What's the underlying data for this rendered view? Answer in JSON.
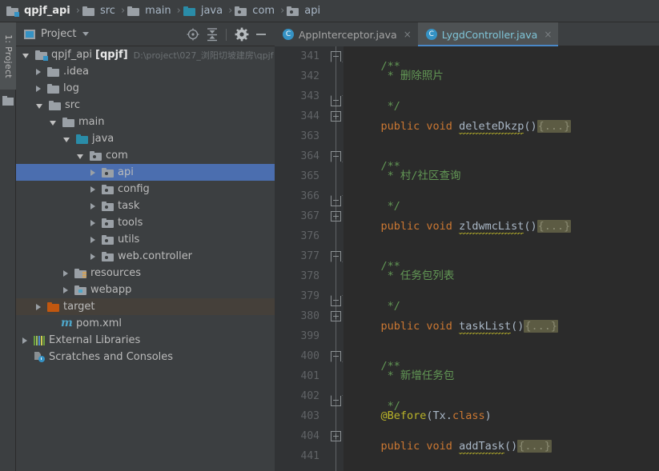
{
  "breadcrumb": [
    {
      "label": "qpjf_api",
      "icon": "folder-module-icon",
      "bold": true
    },
    {
      "label": "src",
      "icon": "folder-icon",
      "bold": false
    },
    {
      "label": "main",
      "icon": "folder-icon",
      "bold": false
    },
    {
      "label": "java",
      "icon": "folder-source-root-icon",
      "bold": false
    },
    {
      "label": "com",
      "icon": "package-icon",
      "bold": false
    },
    {
      "label": "api",
      "icon": "package-icon",
      "bold": false
    }
  ],
  "tool_stripe": {
    "label": "1: Project",
    "icon": "project-folder-icon"
  },
  "project_panel": {
    "title": "Project",
    "icon": "project-view-icon",
    "caret": "chevron-down-icon",
    "actions": [
      {
        "name": "scroll-from-source-icon",
        "title": "Select Opened File"
      },
      {
        "name": "collapse-all-icon",
        "title": "Collapse All"
      },
      {
        "name": "gear-icon",
        "title": "Settings"
      },
      {
        "name": "minimize-icon",
        "title": "Hide"
      }
    ],
    "tree": [
      {
        "label": "qpjf_api",
        "suffix": "[qpjf]",
        "path": "D:\\project\\027_浏阳切坡建房\\qpjf",
        "depth": 0,
        "state": "open",
        "icon": "folder-module-icon",
        "selected": false,
        "excluded": false
      },
      {
        "label": ".idea",
        "depth": 1,
        "state": "closed",
        "icon": "folder-icon",
        "selected": false,
        "excluded": false
      },
      {
        "label": "log",
        "depth": 1,
        "state": "closed",
        "icon": "folder-icon",
        "selected": false,
        "excluded": false
      },
      {
        "label": "src",
        "depth": 1,
        "state": "open",
        "icon": "folder-icon",
        "selected": false,
        "excluded": false
      },
      {
        "label": "main",
        "depth": 2,
        "state": "open",
        "icon": "folder-icon",
        "selected": false,
        "excluded": false
      },
      {
        "label": "java",
        "depth": 3,
        "state": "open",
        "icon": "folder-source-root-icon",
        "selected": false,
        "excluded": false
      },
      {
        "label": "com",
        "depth": 4,
        "state": "open",
        "icon": "package-icon",
        "selected": false,
        "excluded": false
      },
      {
        "label": "api",
        "depth": 5,
        "state": "closed",
        "icon": "package-icon",
        "selected": true,
        "excluded": false
      },
      {
        "label": "config",
        "depth": 5,
        "state": "closed",
        "icon": "package-icon",
        "selected": false,
        "excluded": false
      },
      {
        "label": "task",
        "depth": 5,
        "state": "closed",
        "icon": "package-icon",
        "selected": false,
        "excluded": false
      },
      {
        "label": "tools",
        "depth": 5,
        "state": "closed",
        "icon": "package-icon",
        "selected": false,
        "excluded": false
      },
      {
        "label": "utils",
        "depth": 5,
        "state": "closed",
        "icon": "package-icon",
        "selected": false,
        "excluded": false
      },
      {
        "label": "web.controller",
        "depth": 5,
        "state": "closed",
        "icon": "package-icon",
        "selected": false,
        "excluded": false
      },
      {
        "label": "resources",
        "depth": 3,
        "state": "closed",
        "icon": "folder-resources-icon",
        "selected": false,
        "excluded": false
      },
      {
        "label": "webapp",
        "depth": 3,
        "state": "closed",
        "icon": "folder-web-icon",
        "selected": false,
        "excluded": false
      },
      {
        "label": "target",
        "depth": 1,
        "state": "closed",
        "icon": "folder-excluded-icon",
        "selected": false,
        "excluded": true
      },
      {
        "label": "pom.xml",
        "depth": 2,
        "state": "leaf",
        "icon": "maven-file-icon",
        "selected": false,
        "excluded": false
      },
      {
        "label": "External Libraries",
        "depth": 0,
        "state": "closed",
        "icon": "library-icon",
        "selected": false,
        "excluded": false
      },
      {
        "label": "Scratches and Consoles",
        "depth": 0,
        "state": "leaf",
        "icon": "scratches-icon",
        "selected": false,
        "excluded": false
      }
    ]
  },
  "editor": {
    "tabs": [
      {
        "label": "AppInterceptor.java",
        "icon": "java-class-icon",
        "close": "×",
        "active": false
      },
      {
        "label": "LygdController.java",
        "icon": "java-class-icon",
        "close": "×",
        "active": true
      }
    ],
    "lines": [
      {
        "num": "341",
        "fold": "top",
        "segments": [
          {
            "t": "    /**",
            "c": "c-comment"
          }
        ]
      },
      {
        "num": "342",
        "fold": "none",
        "segments": [
          {
            "t": "     * 删除照片",
            "c": "c-comment"
          }
        ]
      },
      {
        "num": "343",
        "fold": "bottom",
        "segments": [
          {
            "t": "     */",
            "c": "c-comment"
          }
        ]
      },
      {
        "num": "344",
        "fold": "plus",
        "segments": [
          {
            "t": "    ",
            "c": "c-plain"
          },
          {
            "t": "public void ",
            "c": "c-keyword"
          },
          {
            "t": "deleteDkzp",
            "c": "c-method squig"
          },
          {
            "t": "()",
            "c": "c-plain"
          },
          {
            "t": "{...}",
            "c": "fold-box"
          }
        ]
      },
      {
        "num": "363",
        "fold": "none",
        "segments": [
          {
            "t": "",
            "c": "c-plain"
          }
        ]
      },
      {
        "num": "364",
        "fold": "top",
        "segments": [
          {
            "t": "    /**",
            "c": "c-comment"
          }
        ]
      },
      {
        "num": "365",
        "fold": "none",
        "segments": [
          {
            "t": "     * 村/社区查询",
            "c": "c-comment"
          }
        ]
      },
      {
        "num": "366",
        "fold": "bottom",
        "segments": [
          {
            "t": "     */",
            "c": "c-comment"
          }
        ]
      },
      {
        "num": "367",
        "fold": "plus",
        "segments": [
          {
            "t": "    ",
            "c": "c-plain"
          },
          {
            "t": "public void ",
            "c": "c-keyword"
          },
          {
            "t": "zldwmcList",
            "c": "c-method squig"
          },
          {
            "t": "()",
            "c": "c-plain"
          },
          {
            "t": "{...}",
            "c": "fold-box"
          }
        ]
      },
      {
        "num": "376",
        "fold": "none",
        "segments": [
          {
            "t": "",
            "c": "c-plain"
          }
        ]
      },
      {
        "num": "377",
        "fold": "top",
        "segments": [
          {
            "t": "    /**",
            "c": "c-comment"
          }
        ]
      },
      {
        "num": "378",
        "fold": "none",
        "segments": [
          {
            "t": "     * 任务包列表",
            "c": "c-comment"
          }
        ]
      },
      {
        "num": "379",
        "fold": "bottom",
        "segments": [
          {
            "t": "     */",
            "c": "c-comment"
          }
        ]
      },
      {
        "num": "380",
        "fold": "plus",
        "segments": [
          {
            "t": "    ",
            "c": "c-plain"
          },
          {
            "t": "public void ",
            "c": "c-keyword"
          },
          {
            "t": "taskList",
            "c": "c-method squig"
          },
          {
            "t": "()",
            "c": "c-plain"
          },
          {
            "t": "{...}",
            "c": "fold-box"
          }
        ]
      },
      {
        "num": "399",
        "fold": "none",
        "segments": [
          {
            "t": "",
            "c": "c-plain"
          }
        ]
      },
      {
        "num": "400",
        "fold": "top",
        "segments": [
          {
            "t": "    /**",
            "c": "c-comment"
          }
        ]
      },
      {
        "num": "401",
        "fold": "none",
        "segments": [
          {
            "t": "     * 新增任务包",
            "c": "c-comment"
          }
        ]
      },
      {
        "num": "402",
        "fold": "bottom",
        "segments": [
          {
            "t": "     */",
            "c": "c-comment"
          }
        ]
      },
      {
        "num": "403",
        "fold": "none",
        "segments": [
          {
            "t": "    ",
            "c": "c-plain"
          },
          {
            "t": "@Before",
            "c": "c-anno"
          },
          {
            "t": "(Tx.",
            "c": "c-plain"
          },
          {
            "t": "class",
            "c": "c-keyword"
          },
          {
            "t": ")",
            "c": "c-plain"
          }
        ]
      },
      {
        "num": "404",
        "fold": "plus",
        "segments": [
          {
            "t": "    ",
            "c": "c-plain"
          },
          {
            "t": "public void ",
            "c": "c-keyword"
          },
          {
            "t": "addTask",
            "c": "c-method squig"
          },
          {
            "t": "()",
            "c": "c-plain"
          },
          {
            "t": "{...}",
            "c": "fold-box"
          }
        ]
      },
      {
        "num": "441",
        "fold": "none",
        "segments": [
          {
            "t": "",
            "c": "c-plain"
          }
        ]
      }
    ]
  },
  "colors": {
    "panel_bg": "#3c3f41",
    "editor_bg": "#2b2b2b",
    "gutter_bg": "#313335",
    "selection": "#4b6eaf",
    "accent_teal": "#2a8ca8",
    "comment_green": "#629755",
    "keyword_orange": "#cc7832",
    "annotation_yellow": "#bbb529",
    "excluded_orange": "#c1570f",
    "tab_underline": "#4a88c7"
  }
}
